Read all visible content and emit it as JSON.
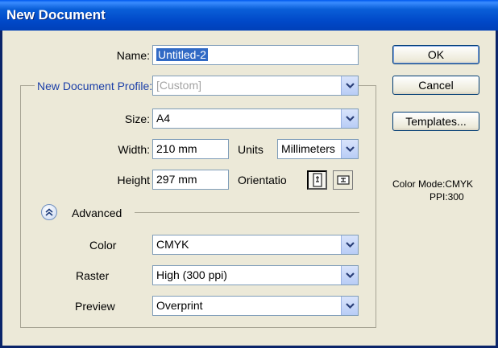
{
  "window": {
    "title": "New Document"
  },
  "name": {
    "label": "Name:",
    "value": "Untitled-2"
  },
  "profile": {
    "label": "New Document Profile:",
    "value": "[Custom]"
  },
  "size": {
    "label": "Size:",
    "value": "A4"
  },
  "width": {
    "label": "Width:",
    "value": "210 mm"
  },
  "units": {
    "label": "Units",
    "value": "Millimeters"
  },
  "height": {
    "label": "Height",
    "value": "297 mm"
  },
  "orientation": {
    "label": "Orientatio",
    "selected": "portrait"
  },
  "advanced": {
    "label": "Advanced"
  },
  "color": {
    "label": "Color",
    "value": "CMYK"
  },
  "raster": {
    "label": "Raster",
    "value": "High (300 ppi)"
  },
  "preview": {
    "label": "Preview",
    "value": "Overprint"
  },
  "buttons": {
    "ok": "OK",
    "cancel": "Cancel",
    "templates": "Templates..."
  },
  "info": {
    "color_mode": "Color Mode:CMYK",
    "ppi": "PPI:300"
  },
  "colors": {
    "title_bar": "#0048c8",
    "dialog_bg": "#ece9d8",
    "selection": "#316ac5",
    "profile_label": "#1b3fa8"
  },
  "icons": {
    "dropdown": "chevron-down-icon",
    "advanced_toggle": "double-chevron-up-icon",
    "portrait": "portrait-orientation-icon",
    "landscape": "landscape-orientation-icon"
  }
}
